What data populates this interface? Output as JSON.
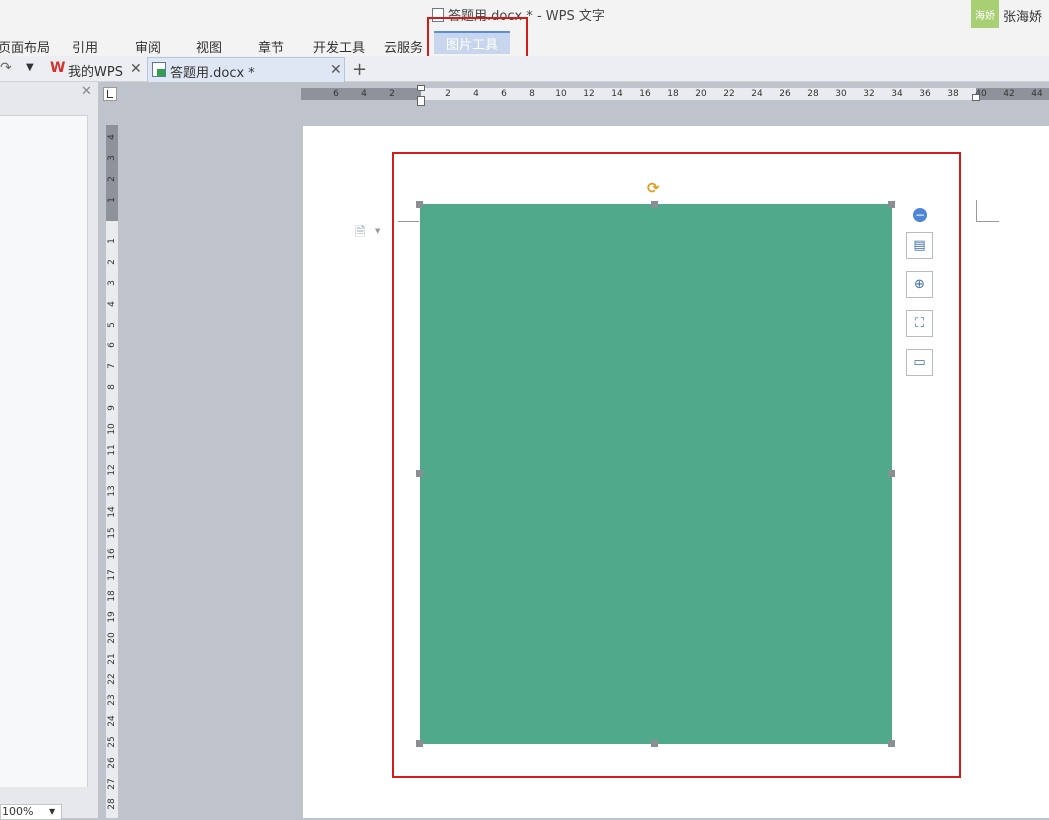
{
  "window": {
    "title": "答题用.docx * - WPS 文字"
  },
  "user": {
    "badge": "海娇",
    "name": "张海娇"
  },
  "ribbon": {
    "tabs": [
      "页面布局",
      "引用",
      "审阅",
      "视图",
      "章节",
      "开发工具",
      "云服务"
    ],
    "active_tab": "图片工具"
  },
  "doc_tabs": {
    "my_wps": "我的WPS",
    "document": "答题用.docx *",
    "new_tab": "+"
  },
  "left_panel": {
    "zoom": "100%"
  },
  "horizontal_ruler": [
    "6",
    "4",
    "2",
    "2",
    "4",
    "6",
    "8",
    "10",
    "12",
    "14",
    "16",
    "18",
    "20",
    "22",
    "24",
    "26",
    "28",
    "30",
    "32",
    "34",
    "36",
    "38",
    "40",
    "42",
    "44"
  ],
  "vertical_ruler": [
    "4",
    "3",
    "2",
    "1",
    "1",
    "2",
    "3",
    "4",
    "5",
    "6",
    "7",
    "8",
    "9",
    "10",
    "11",
    "12",
    "13",
    "14",
    "15",
    "16",
    "17",
    "18",
    "19",
    "20",
    "21",
    "22",
    "23",
    "24",
    "25",
    "26",
    "27",
    "28"
  ],
  "image": {
    "fill_color": "#4fa98a"
  },
  "image_tools": [
    "layout-options",
    "zoom-in",
    "crop",
    "frame"
  ],
  "annotation_color": "#d11c1c"
}
